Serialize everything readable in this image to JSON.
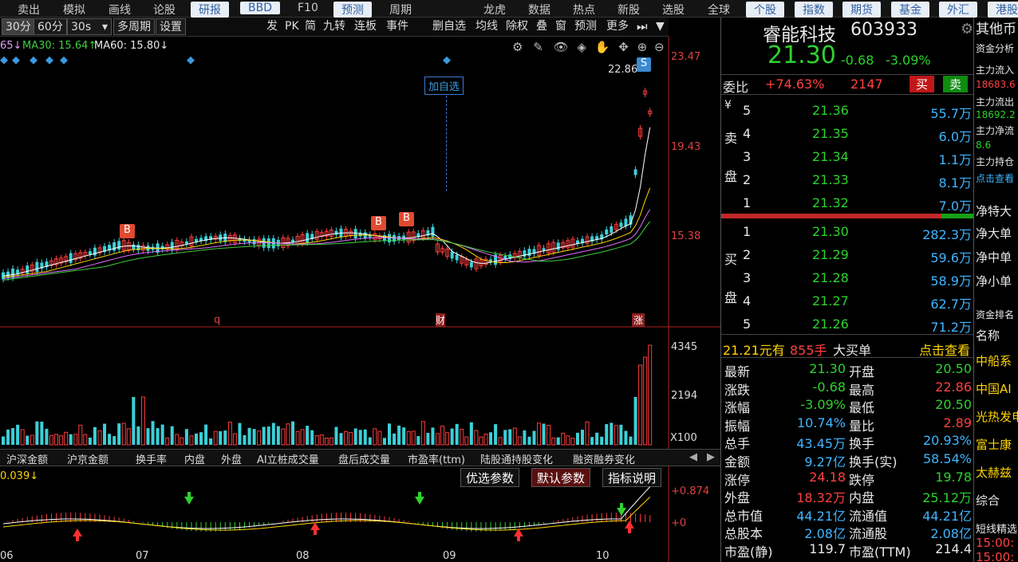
{
  "topmenu": [
    "卖出",
    "模拟",
    "画线",
    "论股",
    "研报",
    "BBD",
    "F10",
    "预测",
    "周期",
    "龙虎",
    "数据",
    "热点",
    "新股",
    "选股",
    "全球",
    "个股",
    "指数",
    "期货",
    "基金",
    "外汇",
    "港股"
  ],
  "toolbar": {
    "p30": "30分",
    "p60": "60分",
    "p30s": "30s",
    "multi": "多周期",
    "settings": "设置",
    "btns": [
      "发",
      "PK",
      "简",
      "九转",
      "连板",
      "事件",
      "删自选",
      "均线",
      "除权",
      "叠",
      "窗",
      "预测",
      "更多"
    ]
  },
  "ma": {
    "ma5": "65↓",
    "ma30": "MA30: 15.64↑",
    "ma60": "MA60: 15.80↓"
  },
  "price_axis": {
    "high": "23.47",
    "mid": "19.43",
    "low": "15.38",
    "peak": "22.86"
  },
  "vol_axis": {
    "top": "4345",
    "mid": "2194",
    "unit": "X100"
  },
  "annotations": {
    "add_watch": "加自选",
    "b": "B",
    "s": "S",
    "q": "q",
    "cai": "财",
    "zhang": "涨"
  },
  "indicator_tabs": [
    "沪深金额",
    "沪京金额",
    "换手率",
    "内盘",
    "外盘",
    "AI立桩成交量",
    "盘后成交量",
    "市盈率(ttm)",
    "陆股通持股变化",
    "融资融券变化"
  ],
  "param_buttons": {
    "opt": "优选参数",
    "def": "默认参数",
    "help": "指标说明"
  },
  "osc": {
    "label": "0.039↓",
    "top": "+0.874",
    "zero": "+0"
  },
  "months": [
    "06",
    "07",
    "08",
    "09",
    "10"
  ],
  "stock": {
    "name": "睿能科技",
    "code": "603933",
    "price": "21.30",
    "chg": "-0.68",
    "pct": "-3.09%"
  },
  "weibi": {
    "label": "委比",
    "ratio": "+74.63%",
    "diff": "2147",
    "buy": "买",
    "sell": "卖"
  },
  "sell_label": [
    "卖",
    "盘"
  ],
  "buy_label": [
    "买",
    "盘"
  ],
  "yen": "¥",
  "asks": [
    {
      "n": "5",
      "p": "21.36",
      "v": "55.7万"
    },
    {
      "n": "4",
      "p": "21.35",
      "v": "6.0万"
    },
    {
      "n": "3",
      "p": "21.34",
      "v": "1.1万"
    },
    {
      "n": "2",
      "p": "21.33",
      "v": "8.1万"
    },
    {
      "n": "1",
      "p": "21.32",
      "v": "7.0万"
    }
  ],
  "bids": [
    {
      "n": "1",
      "p": "21.30",
      "v": "282.3万"
    },
    {
      "n": "2",
      "p": "21.29",
      "v": "59.6万"
    },
    {
      "n": "3",
      "p": "21.28",
      "v": "58.9万"
    },
    {
      "n": "4",
      "p": "21.27",
      "v": "62.7万"
    },
    {
      "n": "5",
      "p": "21.26",
      "v": "71.2万"
    }
  ],
  "bigorder": {
    "price": "21.21元有",
    "hands": "855手",
    "label": "大买单",
    "link": "点击查看"
  },
  "stats": [
    {
      "k1": "最新",
      "v1": "21.30",
      "c1": "g",
      "k2": "开盘",
      "v2": "20.50",
      "c2": "g"
    },
    {
      "k1": "涨跌",
      "v1": "-0.68",
      "c1": "g",
      "k2": "最高",
      "v2": "22.86",
      "c2": "r"
    },
    {
      "k1": "涨幅",
      "v1": "-3.09%",
      "c1": "g",
      "k2": "最低",
      "v2": "20.50",
      "c2": "g"
    },
    {
      "k1": "振幅",
      "v1": "10.74%",
      "c1": "c",
      "k2": "量比",
      "v2": "2.89",
      "c2": "r"
    },
    {
      "k1": "总手",
      "v1": "43.45万",
      "c1": "c",
      "k2": "换手",
      "v2": "20.93%",
      "c2": "c"
    },
    {
      "k1": "金额",
      "v1": "9.27亿",
      "c1": "c",
      "k2": "换手(实)",
      "v2": "58.54%",
      "c2": "c"
    },
    {
      "k1": "涨停",
      "v1": "24.18",
      "c1": "r",
      "k2": "跌停",
      "v2": "19.78",
      "c2": "g"
    },
    {
      "k1": "外盘",
      "v1": "18.32万",
      "c1": "r",
      "k2": "内盘",
      "v2": "25.12万",
      "c2": "g"
    },
    {
      "k1": "总市值",
      "v1": "44.21亿",
      "c1": "c",
      "k2": "流通值",
      "v2": "44.21亿",
      "c2": "c"
    },
    {
      "k1": "总股本",
      "v1": "2.08亿",
      "c1": "c",
      "k2": "流通股",
      "v2": "2.08亿",
      "c2": "c"
    },
    {
      "k1": "市盈(静)",
      "v1": "119.7",
      "c1": "w",
      "k2": "市盈(TTM)",
      "v2": "214.4",
      "c2": "w"
    }
  ],
  "far": {
    "title": "其他币",
    "l1": "资金分析",
    "l2": "主力流入",
    "v2": "18683.6",
    "l3": "主力流出",
    "v3": "18692.2",
    "l4": "主力净流",
    "v4": "8.6",
    "l5": "主力持仓",
    "l6": "点击查看",
    "net": [
      "净特大",
      "净大单",
      "净中单",
      "净小单"
    ],
    "rank": "资金排名",
    "name": "名称",
    "items": [
      "中船系",
      "中国AI",
      "光热发电",
      "富士康",
      "太赫兹",
      "综合"
    ],
    "short": "短线精选",
    "t1": "15:00:",
    "t2": "15:00:"
  }
}
